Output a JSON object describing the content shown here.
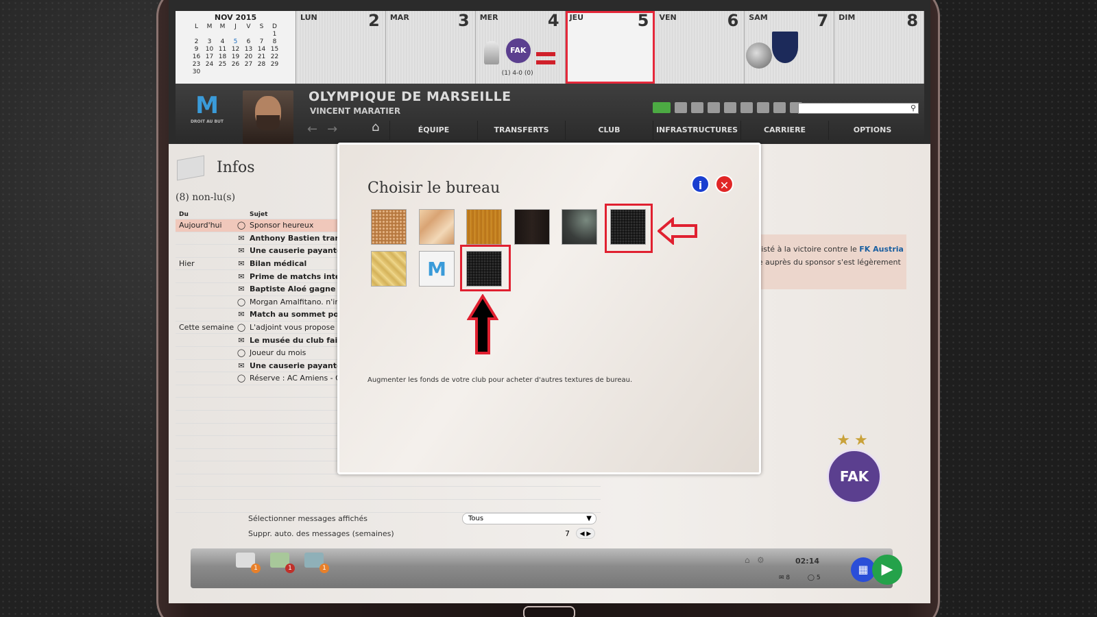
{
  "calendar": {
    "month": "NOV 2015",
    "weekday_heads": [
      "L",
      "M",
      "M",
      "J",
      "V",
      "S",
      "D"
    ],
    "weeks": [
      [
        "",
        "",
        "",
        "",
        "",
        "",
        "1"
      ],
      [
        "2",
        "3",
        "4",
        "5",
        "6",
        "7",
        "8"
      ],
      [
        "9",
        "10",
        "11",
        "12",
        "13",
        "14",
        "15"
      ],
      [
        "16",
        "17",
        "18",
        "19",
        "20",
        "21",
        "22"
      ],
      [
        "23",
        "24",
        "25",
        "26",
        "27",
        "28",
        "29"
      ],
      [
        "30",
        "",
        "",
        "",
        "",
        "",
        ""
      ]
    ],
    "days": [
      {
        "name": "LUN",
        "num": "2"
      },
      {
        "name": "MAR",
        "num": "3"
      },
      {
        "name": "MER",
        "num": "4",
        "score": "(1) 4-0 (0)"
      },
      {
        "name": "JEU",
        "num": "5"
      },
      {
        "name": "VEN",
        "num": "6"
      },
      {
        "name": "SAM",
        "num": "7"
      },
      {
        "name": "DIM",
        "num": "8"
      }
    ]
  },
  "header": {
    "club": "OLYMPIQUE DE MARSEILLE",
    "manager": "VINCENT MARATIER",
    "logo_text": "M",
    "logo_sub": "DROIT AU BUT",
    "nav": [
      "ÉQUIPE",
      "TRANSFERTS",
      "CLUB",
      "INFRASTRUCTURES",
      "CARRIERE",
      "OPTIONS"
    ]
  },
  "infos": {
    "title": "Infos",
    "unread": "(8) non-lu(s)",
    "col_from": "Du",
    "col_subject": "Sujet",
    "messages": [
      {
        "from": "Aujourd'hui",
        "subject": "Sponsor heureux",
        "bold": false
      },
      {
        "from": "",
        "subject": "Anthony Bastien trans",
        "bold": true
      },
      {
        "from": "",
        "subject": "Une causerie payante",
        "bold": true
      },
      {
        "from": "Hier",
        "subject": "Bilan médical",
        "bold": true
      },
      {
        "from": "",
        "subject": "Prime de matchs intern",
        "bold": true
      },
      {
        "from": "",
        "subject": "Baptiste Aloé gagne en",
        "bold": true
      },
      {
        "from": "",
        "subject": "Morgan Amalfitano. n'inté",
        "bold": false
      },
      {
        "from": "",
        "subject": "Match au sommet pour",
        "bold": true
      },
      {
        "from": "Cette semaine",
        "subject": "L'adjoint vous propose so",
        "bold": false
      },
      {
        "from": "",
        "subject": "Le musée du club fait d",
        "bold": true
      },
      {
        "from": "",
        "subject": "Joueur du mois",
        "bold": false
      },
      {
        "from": "",
        "subject": "Une causerie payante",
        "bold": true
      },
      {
        "from": "",
        "subject": "Réserve : AC Amiens - Oly",
        "bold": false
      }
    ],
    "select_label": "Sélectionner messages affichés",
    "select_value": "Tous",
    "delete_label": "Suppr. auto. des messages (semaines)",
    "delete_value": "7",
    "news_line1_prefix": "assisté à la victoire contre le ",
    "news_link": "FK Austria",
    "news_line2": "age auprès du sponsor s'est légèrement"
  },
  "statusbar": {
    "badges": [
      "1",
      "1",
      "1"
    ],
    "time": "02:14",
    "mail_count": "8",
    "chat_count": "5"
  },
  "modal": {
    "title": "Choisir le bureau",
    "info": "i",
    "close": "✕",
    "note": "Augmenter les fonds de votre club pour acheter d'autres textures de bureau."
  },
  "colors": {
    "highlight": "#e02030",
    "accent": "#1a3fd0",
    "play": "#24a24a"
  }
}
